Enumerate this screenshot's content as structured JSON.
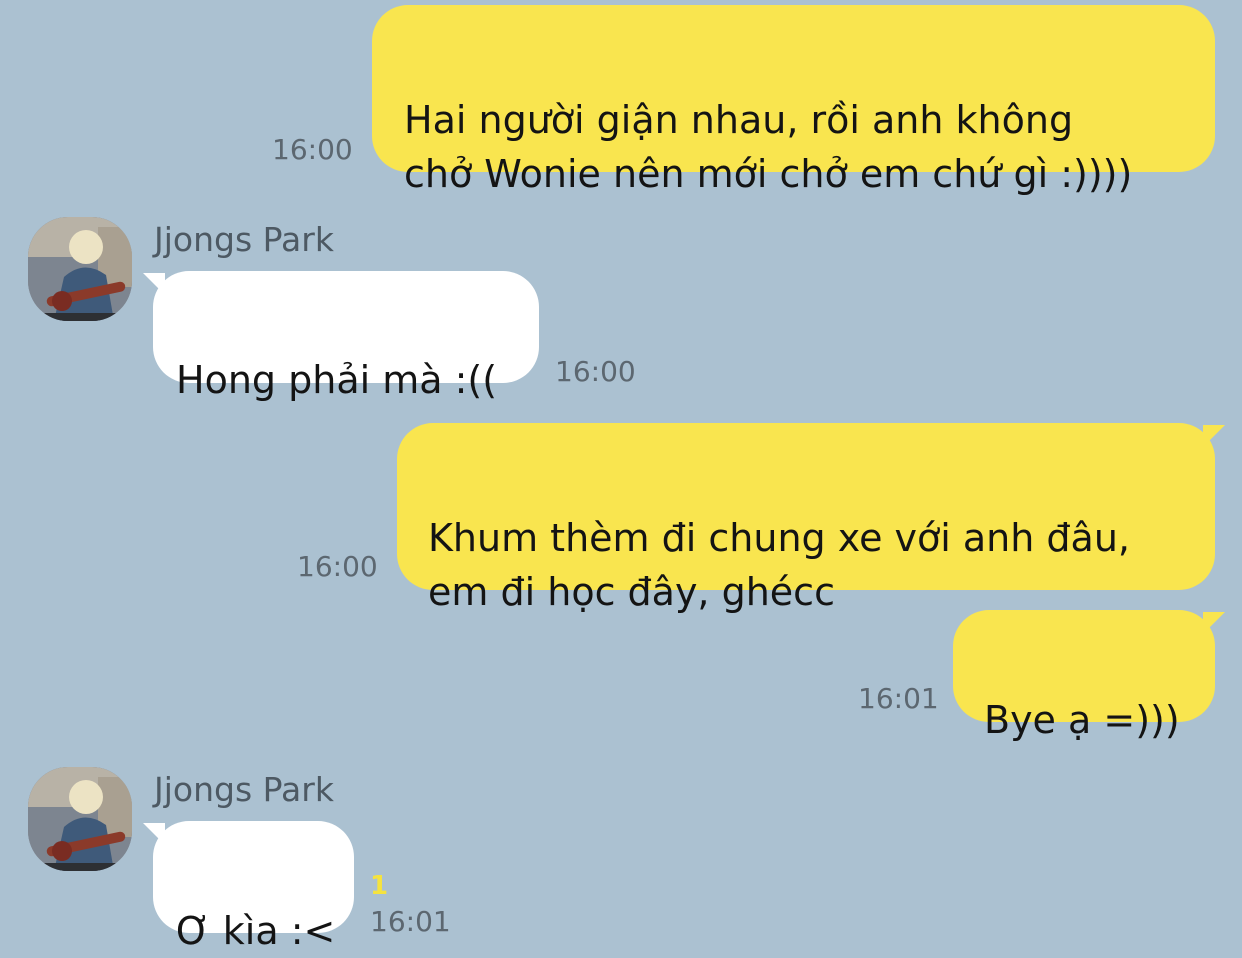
{
  "theme": {
    "chat_bg": "#abc1d1",
    "outgoing_bubble": "#f9e54f",
    "incoming_bubble": "#ffffff",
    "unread_color": "#f5e33f"
  },
  "messages": [
    {
      "direction": "out",
      "text": "Hai người giận nhau, rồi anh không\nchở Wonie nên mới chở em chứ gì :))))",
      "time": "16:00"
    },
    {
      "direction": "in",
      "sender": "Jjongs Park",
      "avatar_icon": "avatar-guitarist-icon",
      "text": "Hong phải mà :((",
      "time": "16:00"
    },
    {
      "direction": "out",
      "text": "Khum thèm đi chung xe với anh đâu,\nem đi học đây, ghécc",
      "time": "16:00"
    },
    {
      "direction": "out",
      "text": "Bye ạ =)))",
      "time": "16:01"
    },
    {
      "direction": "in",
      "sender": "Jjongs Park",
      "avatar_icon": "avatar-guitarist-icon",
      "text": "Ơ kìa :<",
      "time": "16:01",
      "unread_count": "1"
    }
  ]
}
